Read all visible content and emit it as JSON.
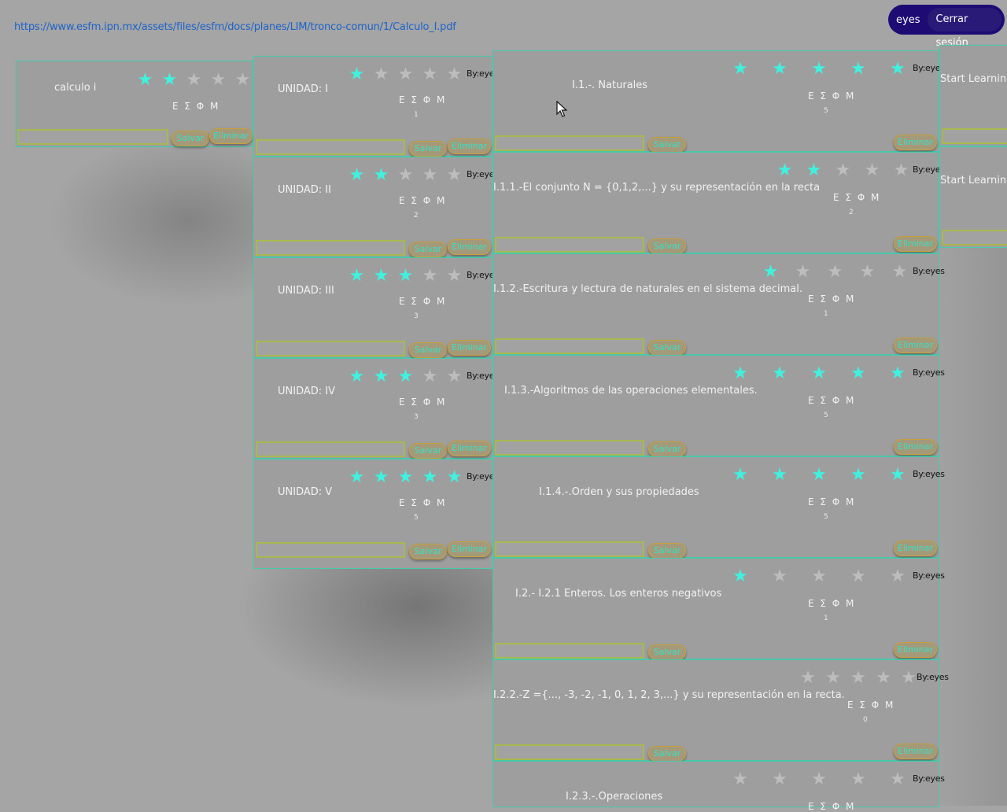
{
  "header": {
    "url_link": "https://www.esfm.ipn.mx/assets/files/esfm/docs/planes/LIM/tronco-comun/1/Calculo_I.pdf",
    "username": "eyes",
    "logout_label": "Cerrar sesión"
  },
  "common": {
    "greek": "Ε Σ Φ Μ",
    "by": "By:eyes",
    "save_label": "Salvar",
    "delete_label": "Eliminar"
  },
  "course": {
    "title": "calculo i",
    "stars": 2
  },
  "units": [
    {
      "title": "UNIDAD: I",
      "stars": 1,
      "count": "1"
    },
    {
      "title": "UNIDAD: II",
      "stars": 2,
      "count": "2"
    },
    {
      "title": "UNIDAD: III",
      "stars": 3,
      "count": "3"
    },
    {
      "title": "UNIDAD: IV",
      "stars": 3,
      "count": "3"
    },
    {
      "title": "UNIDAD: V",
      "stars": 5,
      "count": "5"
    }
  ],
  "topics": [
    {
      "title": "I.1.-. Naturales",
      "stars": 5,
      "count": "5"
    },
    {
      "title": "I.1.1.-El conjunto N = {0,1,2,...} y su representación en la recta",
      "stars": 2,
      "count": "2"
    },
    {
      "title": "I.1.2.-Escritura y lectura de naturales en el sistema decimal.",
      "stars": 1,
      "count": "1"
    },
    {
      "title": "I.1.3.-Algoritmos de las operaciones elementales.",
      "stars": 5,
      "count": "5"
    },
    {
      "title": "I.1.4.-.Orden y sus propiedades",
      "stars": 5,
      "count": "5"
    },
    {
      "title": "I.2.- I.2.1 Enteros. Los enteros negativos",
      "stars": 1,
      "count": "1"
    },
    {
      "title": "I.2.2.-Z ={..., -3, -2, -1, 0, 1, 2, 3,...} y su representación en la recta.",
      "stars": 0,
      "count": "0"
    },
    {
      "title": "I.2.3.-.Operaciones",
      "stars": 0,
      "count": ""
    }
  ],
  "resources": [
    {
      "title": "Start Learning I"
    },
    {
      "title": "Start Learning I"
    }
  ],
  "colors": {
    "star_on": "#3ef2df",
    "star_off": "#bdbdbd",
    "border": "#4bc9ad",
    "pill": "#1e0c74"
  },
  "icons": {
    "star": "star-icon",
    "cursor": "mouse-pointer-icon"
  }
}
